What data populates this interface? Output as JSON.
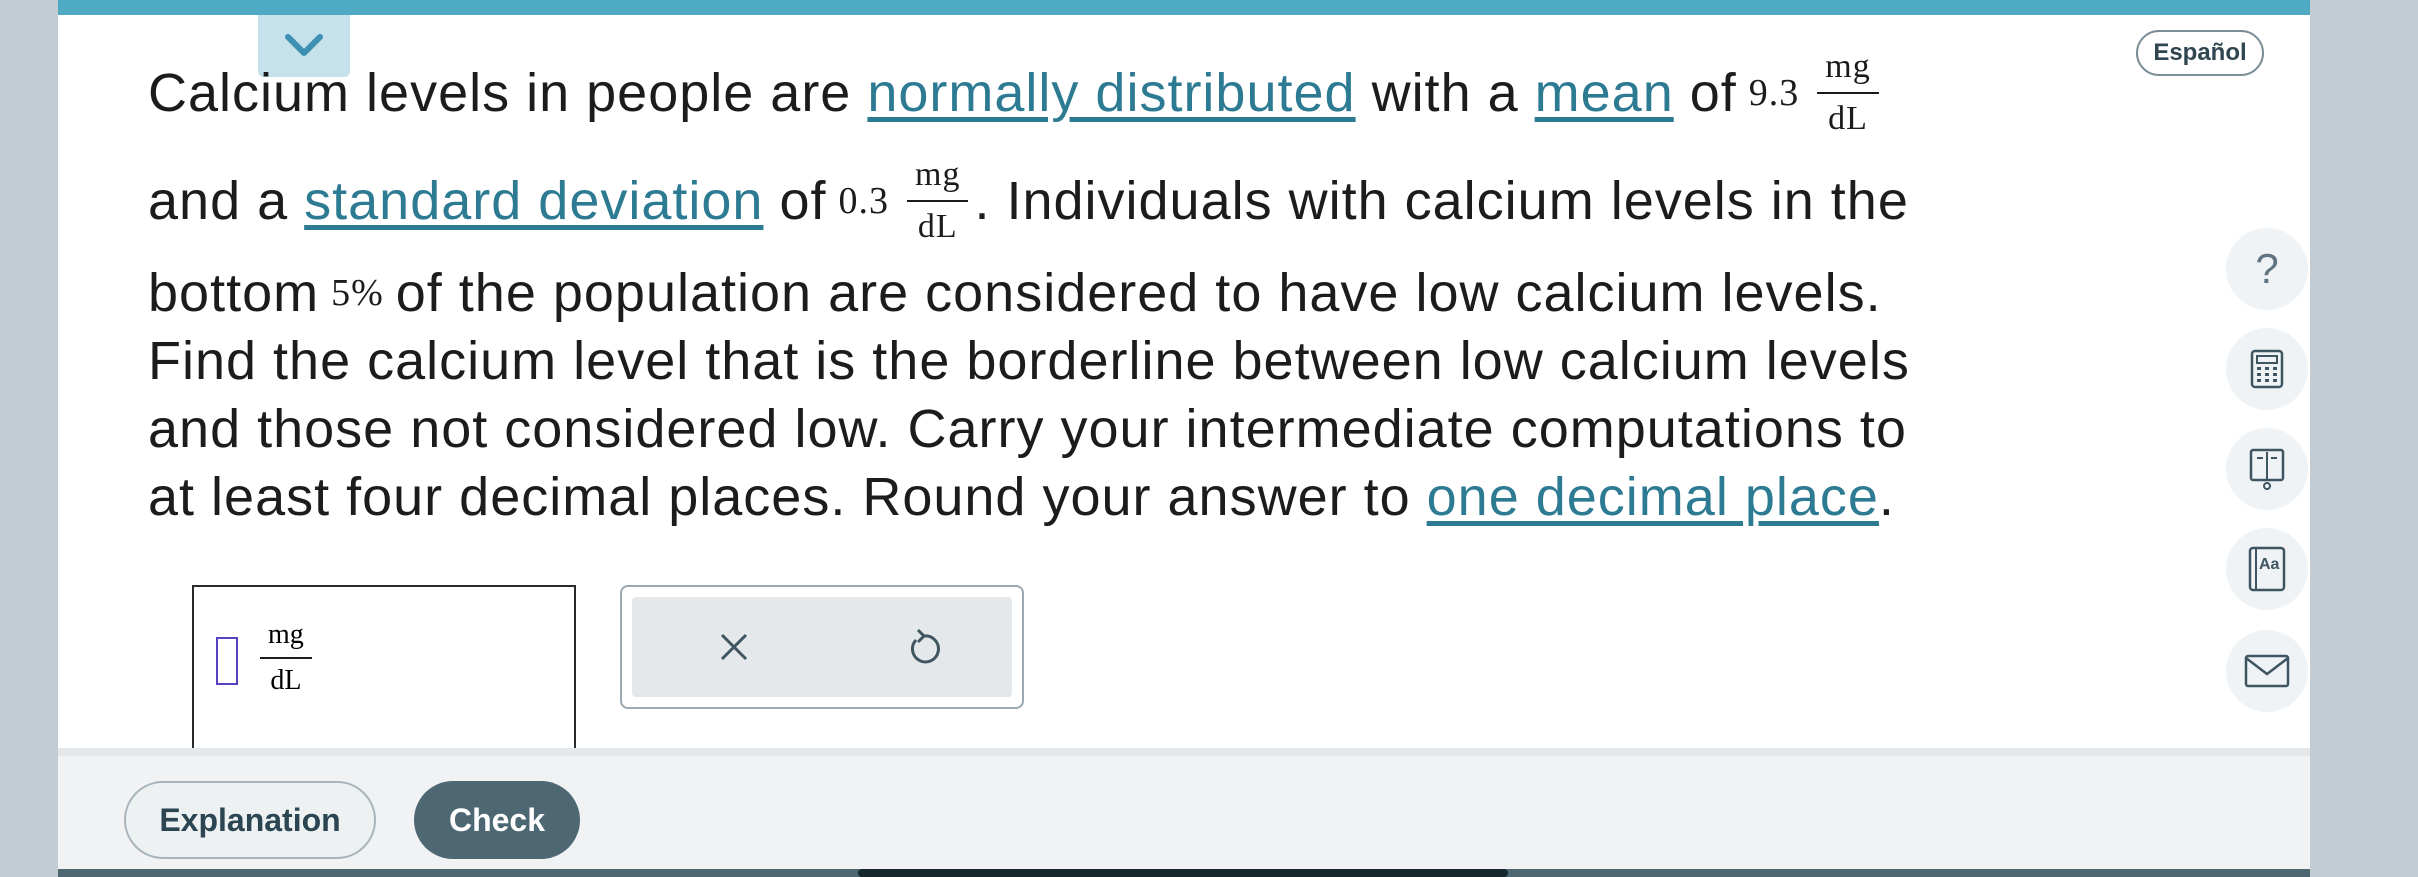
{
  "language_button": "Español",
  "question": {
    "line1": {
      "t1": "Calcium levels in people are ",
      "link1": "normally distributed",
      "t2": " with a ",
      "link2": "mean",
      "t3": " of",
      "mean_value": "9.3",
      "unit_num": "mg",
      "unit_den": "dL"
    },
    "line2": {
      "t1": "and a ",
      "link1": "standard deviation",
      "t2": " of",
      "sd_value": "0.3",
      "unit_num": "mg",
      "unit_den": "dL",
      "t3": ". Individuals with calcium levels in the"
    },
    "line3": {
      "t1": "bottom",
      "pct": "5%",
      "t2": "of the population are considered to have low calcium levels."
    },
    "line4": "Find the calcium level that is the borderline between low calcium levels",
    "line5": "and those not considered low. Carry your intermediate computations to",
    "line6": {
      "t1": "at least four decimal places. Round your answer to ",
      "link1": "one decimal place",
      "t2": "."
    }
  },
  "answer": {
    "value": "",
    "unit_num": "mg",
    "unit_den": "dL"
  },
  "tools": {
    "help": "?",
    "icons": [
      "help-icon",
      "calculator-icon",
      "data-table-icon",
      "glossary-icon",
      "mail-icon"
    ],
    "glossary_text": "Aa"
  },
  "tool_panel": {
    "icons": [
      "clear-icon",
      "undo-icon"
    ]
  },
  "footer": {
    "explanation": "Explanation",
    "check": "Check"
  },
  "colors": {
    "accent": "#4faac4",
    "link": "#2d7a93",
    "check_button": "#4d6873"
  }
}
